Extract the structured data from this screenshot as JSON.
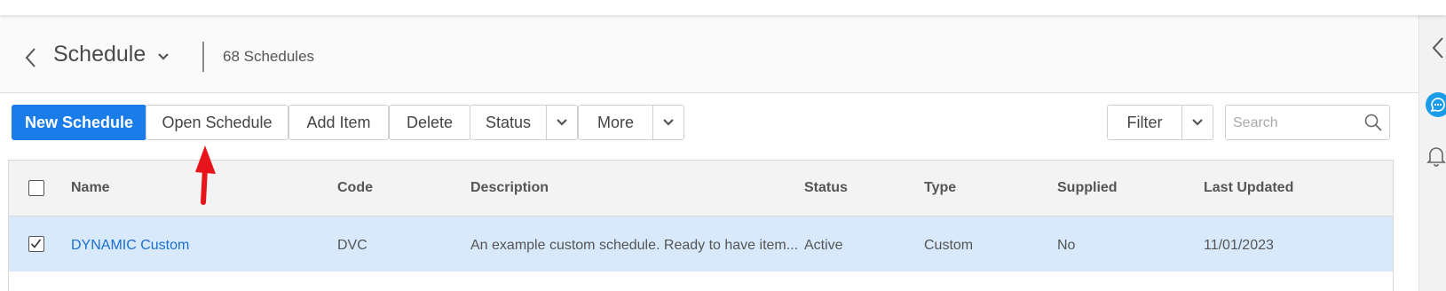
{
  "header": {
    "title": "Schedule",
    "count_label": "68 Schedules"
  },
  "toolbar": {
    "new_label": "New Schedule",
    "open_label": "Open Schedule",
    "add_item_label": "Add Item",
    "delete_label": "Delete",
    "status_label": "Status",
    "more_label": "More",
    "filter_label": "Filter",
    "search_placeholder": "Search"
  },
  "table": {
    "columns": [
      "Name",
      "Code",
      "Description",
      "Status",
      "Type",
      "Supplied",
      "Last Updated"
    ],
    "rows": [
      {
        "selected": true,
        "name": "DYNAMIC Custom",
        "code": "DVC",
        "description": "An example custom schedule. Ready to have item...",
        "status": "Active",
        "type": "Custom",
        "supplied": "No",
        "last_updated": "11/01/2023"
      }
    ]
  },
  "colors": {
    "primary": "#1a7ce8",
    "selected_row": "#d8e9fb",
    "link": "#1a6fd0",
    "annotation_arrow": "#e8141b"
  },
  "icons": [
    "chevron-left-icon",
    "chevron-down-icon",
    "search-icon",
    "checkbox-icon",
    "chat-icon",
    "bell-icon"
  ]
}
